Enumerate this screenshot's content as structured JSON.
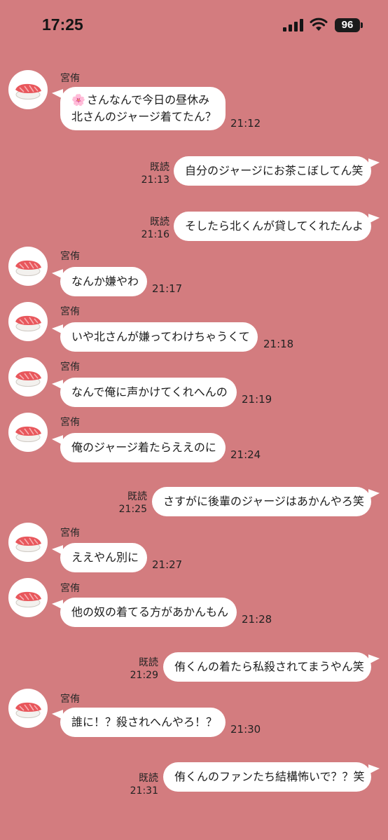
{
  "status_bar": {
    "time": "17:25",
    "battery": "96"
  },
  "read_label": "既読",
  "sender_name": "宮侑",
  "messages": [
    {
      "side": "in",
      "text_line1": "さんなんで今日の昼休み",
      "text_line2": "北さんのジャージ着てたん？",
      "time": "21:12"
    },
    {
      "side": "out",
      "text": "自分のジャージにお茶こぼしてん笑",
      "time": "21:13"
    },
    {
      "side": "out",
      "text": "そしたら北くんが貸してくれたんよ",
      "time": "21:16"
    },
    {
      "side": "in",
      "text": "なんか嫌やわ",
      "time": "21:17"
    },
    {
      "side": "in",
      "text": "いや北さんが嫌ってわけちゃうくて",
      "time": "21:18"
    },
    {
      "side": "in",
      "text": "なんで俺に声かけてくれへんの",
      "time": "21:19"
    },
    {
      "side": "in",
      "text": "俺のジャージ着たらええのに",
      "time": "21:24"
    },
    {
      "side": "out",
      "text": "さすがに後輩のジャージはあかんやろ笑",
      "time": "21:25"
    },
    {
      "side": "in",
      "text": "ええやん別に",
      "time": "21:27"
    },
    {
      "side": "in",
      "text": "他の奴の着てる方があかんもん",
      "time": "21:28"
    },
    {
      "side": "out",
      "text": "侑くんの着たら私殺されてまうやん笑",
      "time": "21:29"
    },
    {
      "side": "in",
      "text": "誰に！？殺されへんやろ！？",
      "time": "21:30"
    },
    {
      "side": "out",
      "text": "侑くんのファンたち結構怖いで？？笑",
      "time": "21:31"
    }
  ],
  "icons": {
    "avatar": "sushi-icon",
    "flower": "cherry-blossom-icon"
  },
  "colors": {
    "background": "#d37c7f",
    "bubble": "#ffffff"
  }
}
